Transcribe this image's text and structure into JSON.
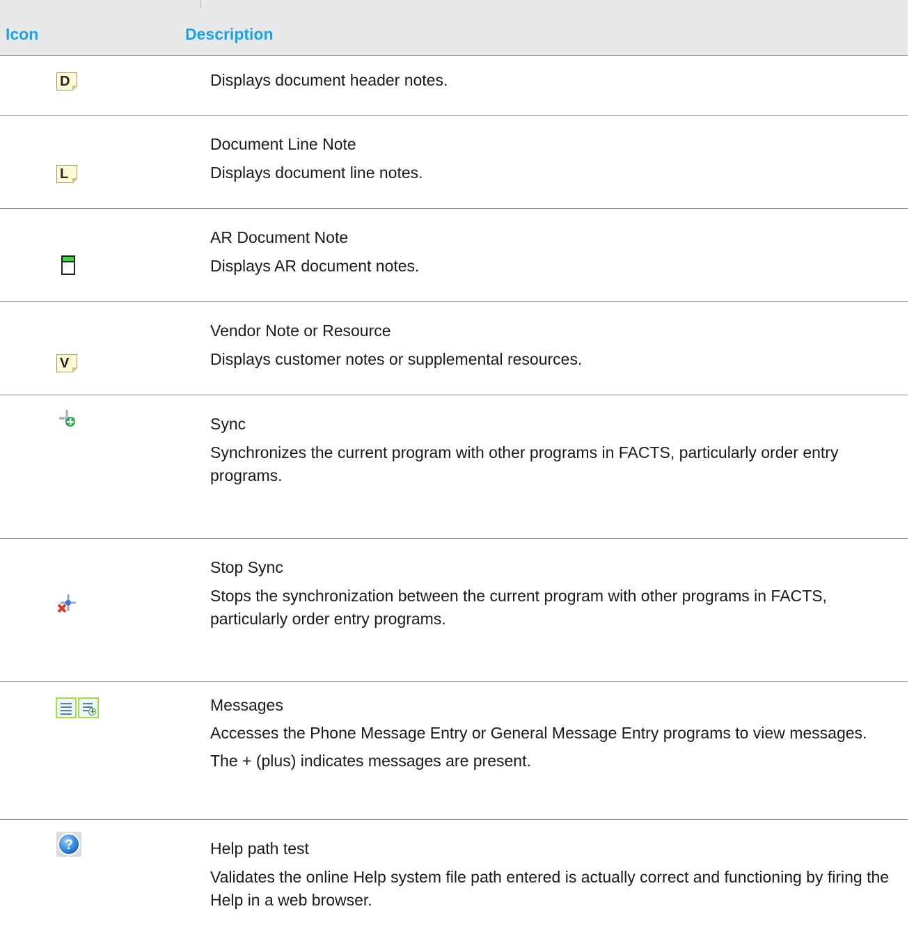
{
  "header": {
    "icon_col": "Icon",
    "description_col": "Description"
  },
  "rows": [
    {
      "icon": "document-header-note-icon",
      "icon_letter": "D",
      "title": "",
      "lines": [
        "Displays document header notes."
      ]
    },
    {
      "icon": "document-line-note-icon",
      "icon_letter": "L",
      "title": "Document Line Note",
      "lines": [
        "Displays document line notes."
      ]
    },
    {
      "icon": "ar-document-note-icon",
      "title": "AR Document Note",
      "lines": [
        "Displays AR document notes."
      ]
    },
    {
      "icon": "vendor-note-icon",
      "icon_letter": "V",
      "title": "Vendor Note or Resource",
      "lines": [
        "Displays customer notes or supplemental resources."
      ]
    },
    {
      "icon": "sync-icon",
      "title": "Sync",
      "lines": [
        "Synchronizes the current program with other programs in FACTS, particularly order entry programs."
      ]
    },
    {
      "icon": "stop-sync-icon",
      "title": "Stop Sync",
      "lines": [
        "Stops the synchronization between the current program with other programs in FACTS, particularly order entry programs."
      ]
    },
    {
      "icon": "messages-icon",
      "title": "Messages",
      "lines": [
        "Accesses the Phone Message Entry or General Message Entry programs to view messages.",
        "The + (plus) indicates messages are present."
      ]
    },
    {
      "icon": "help-icon",
      "title": "Help path test",
      "lines": [
        "Validates the online Help system file path entered is actually correct and functioning by firing the Help in a web browser."
      ]
    }
  ],
  "colors": {
    "header_text": "#1aa3e8",
    "header_bg": "#e8e8e8",
    "rule": "#8a8a8a"
  }
}
